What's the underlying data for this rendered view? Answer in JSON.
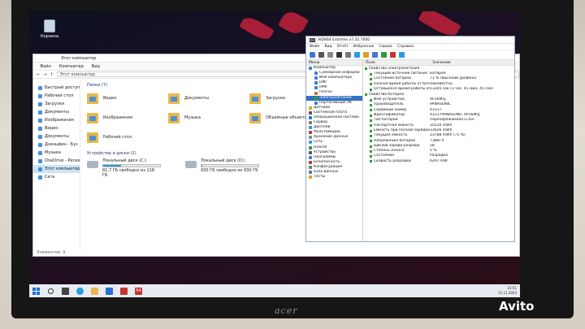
{
  "desktop": {
    "recycle_bin": "Корзина"
  },
  "explorer": {
    "title": "Этот компьютер",
    "ribbon": [
      "Файл",
      "Компьютер",
      "Вид"
    ],
    "address": "Этот компьютер",
    "nav": [
      "Быстрый доступ",
      "Рабочий стол",
      "Загрузки",
      "Документы",
      "Изображения",
      "Видео",
      "Документы",
      "Дзеньфин - Буз",
      "Музыка",
      "OneDrive - Personal",
      "Этот компьютер",
      "Сеть"
    ],
    "folders_header": "Папки (7)",
    "folders": [
      "Видео",
      "Документы",
      "Загрузки",
      "Изображения",
      "Музыка",
      "Объемные объекты",
      "Рабочий стол"
    ],
    "drives_header": "Устройства и диски (2)",
    "drives": [
      {
        "name": "Локальный диск (C:)",
        "free": "81,7 ГБ свободно из 118 ГБ",
        "used_fraction": 0.31
      },
      {
        "name": "Локальный диск (D:)",
        "free": "930 ГБ свободно из 930 ГБ",
        "used_fraction": 0.01
      }
    ],
    "status": "Элементов: 9"
  },
  "aida": {
    "title": "AIDA64 Extreme v7.35.7000",
    "menu": [
      "Файл",
      "Вид",
      "Отчёт",
      "Избранное",
      "Сервис",
      "Справка"
    ],
    "tree_header": "Меню",
    "list_header": [
      "Поле",
      "Значение"
    ],
    "tree": [
      "Компьютер",
      "Суммарная информа",
      "Имя компьютера",
      "DMI",
      "IPMI",
      "Разгон",
      "Электропитание",
      "Портативный ПК",
      "Датчики",
      "Системная плата",
      "Операционная система",
      "Сервер",
      "Дисплей",
      "Мультимедиа",
      "Хранение данных",
      "Сеть",
      "DirectX",
      "Устройства",
      "Программы",
      "Безопасность",
      "Конфигурация",
      "База данных",
      "Тесты"
    ],
    "section1": "Свойства электропитания",
    "rows1": [
      {
        "field": "Текущий источник питания",
        "value": "Батарея"
      },
      {
        "field": "Состояние батареи",
        "value": "71 % (Высокий уровень)"
      },
      {
        "field": "Полное время работы от батар...",
        "value": "Неизвестно"
      },
      {
        "field": "Оставшееся время работы от...",
        "value": "13305 сек (3 час, 41 мин, 45 сек)"
      }
    ],
    "section2": "Свойства батареи",
    "rows2": [
      {
        "field": "Имя устройства",
        "value": "AP16M5J"
      },
      {
        "field": "Производитель",
        "value": "PANASONIC"
      },
      {
        "field": "Серийный номер",
        "value": "43117"
      },
      {
        "field": "Идентификатор",
        "value": "43117PANASONIC AP16M5J"
      },
      {
        "field": "Тип батареи",
        "value": "Перезаряжаемая Li-Ion"
      },
      {
        "field": "Паспортная ёмкость",
        "value": "35520 mWh"
      },
      {
        "field": "Ёмкость при полной зарядке",
        "value": "33626 mWh"
      },
      {
        "field": "Текущая ёмкость",
        "value": "23788 mWh (71 %)"
      },
      {
        "field": "Напряжение батареи",
        "value": "7,880 V"
      },
      {
        "field": "Циклов заряда-разряда",
        "value": "28"
      },
      {
        "field": "Степень износа",
        "value": "5 %"
      },
      {
        "field": "Состояние",
        "value": "Разрядка"
      },
      {
        "field": "Скорость разрядки",
        "value": "6297 mW"
      }
    ]
  },
  "taskbar": {
    "aida_badge": "64",
    "time": "21:51",
    "date": "11.11.2024"
  },
  "brand": "acer",
  "watermark": "Avito"
}
